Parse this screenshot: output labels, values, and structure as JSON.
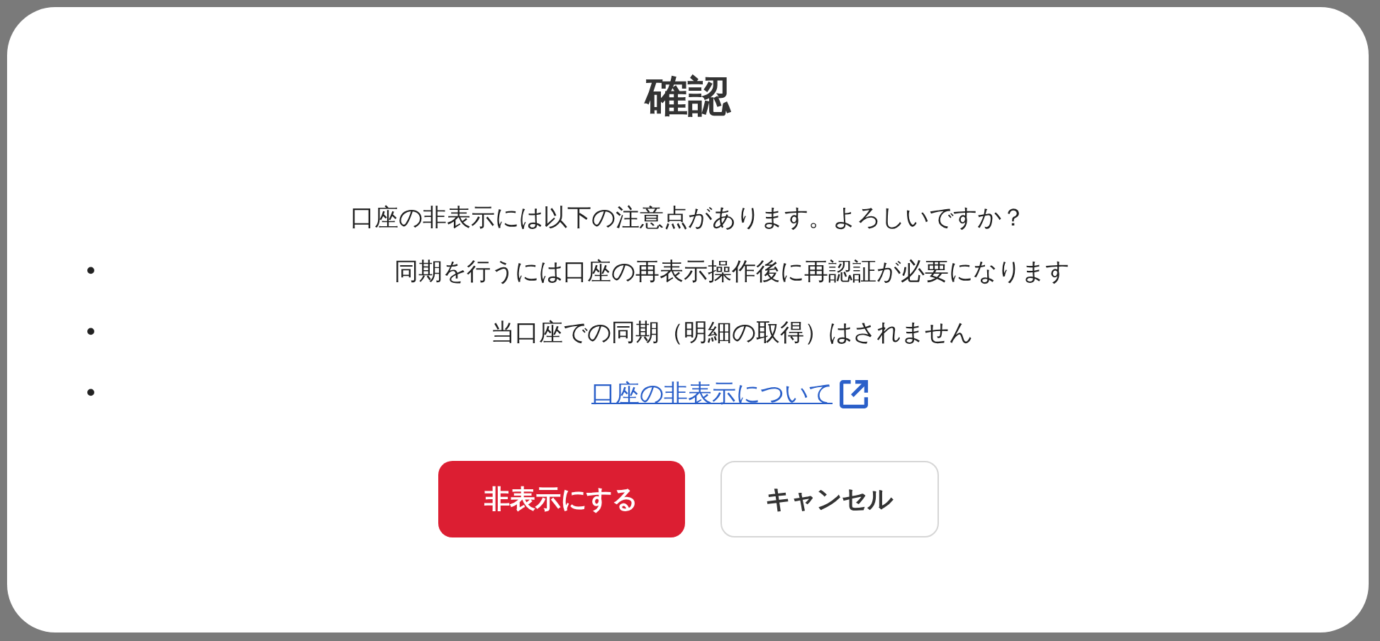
{
  "dialog": {
    "title": "確認",
    "message": "口座の非表示には以下の注意点があります。よろしいですか？",
    "notes": [
      {
        "kind": "text",
        "bullet": "•",
        "text": "同期を行うには口座の再表示操作後に再認証が必要になります"
      },
      {
        "kind": "text",
        "bullet": "•",
        "text": "当口座での同期（明細の取得）はされません"
      },
      {
        "kind": "link",
        "bullet": "•",
        "text": "口座の非表示について"
      }
    ],
    "buttons": [
      {
        "kind": "primary",
        "label": "非表示にする"
      },
      {
        "kind": "secondary",
        "label": "キャンセル"
      }
    ]
  }
}
